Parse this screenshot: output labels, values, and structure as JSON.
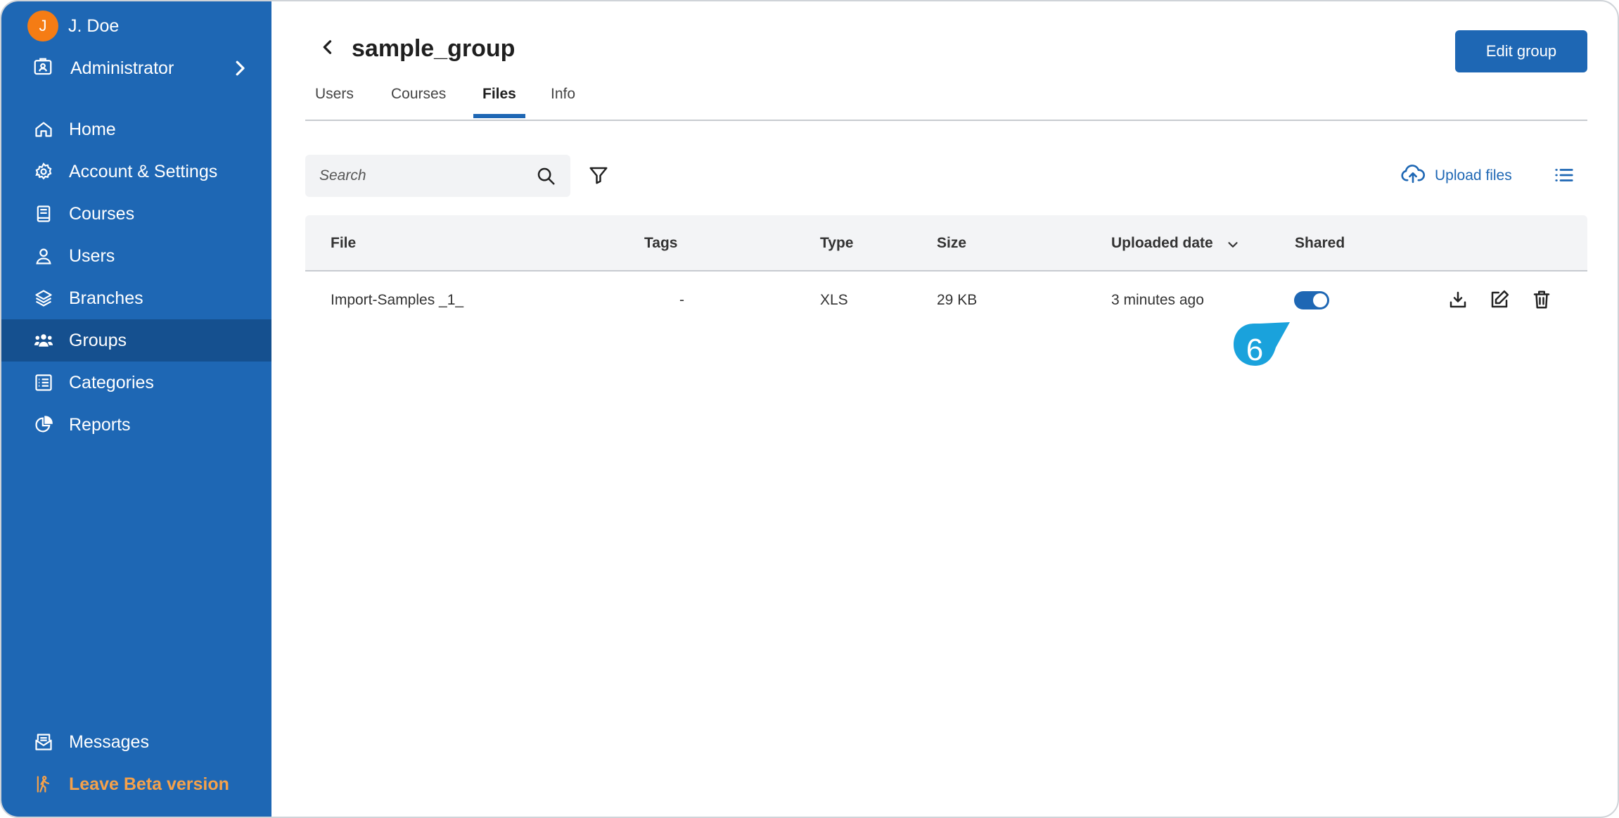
{
  "user": {
    "initial": "J",
    "name": "J. Doe"
  },
  "role": {
    "label": "Administrator"
  },
  "nav": {
    "items": [
      {
        "label": "Home",
        "icon": "home-icon"
      },
      {
        "label": "Account & Settings",
        "icon": "gear-icon"
      },
      {
        "label": "Courses",
        "icon": "book-icon"
      },
      {
        "label": "Users",
        "icon": "user-icon"
      },
      {
        "label": "Branches",
        "icon": "layers-icon"
      },
      {
        "label": "Groups",
        "icon": "group-icon",
        "active": true
      },
      {
        "label": "Categories",
        "icon": "list-box-icon"
      },
      {
        "label": "Reports",
        "icon": "pie-chart-icon"
      }
    ],
    "bottom": [
      {
        "label": "Messages",
        "icon": "envelope-icon"
      },
      {
        "label": "Leave Beta version",
        "icon": "exit-walk-icon"
      }
    ]
  },
  "page": {
    "title": "sample_group",
    "edit_label": "Edit group"
  },
  "tabs": [
    {
      "label": "Users"
    },
    {
      "label": "Courses"
    },
    {
      "label": "Files",
      "active": true
    },
    {
      "label": "Info"
    }
  ],
  "toolbar": {
    "search_placeholder": "Search",
    "upload_label": "Upload files"
  },
  "table": {
    "headers": {
      "file": "File",
      "tags": "Tags",
      "type": "Type",
      "size": "Size",
      "uploaded": "Uploaded date",
      "shared": "Shared"
    },
    "rows": [
      {
        "file": "Import-Samples _1_",
        "tags": "-",
        "type": "XLS",
        "size": "29 KB",
        "uploaded": "3 minutes ago",
        "shared": true
      }
    ]
  },
  "callout": {
    "number": "6"
  },
  "colors": {
    "sidebar": "#1e67b4",
    "sidebar_active": "#15508f",
    "accent": "#1e67b4",
    "avatar": "#f57c14",
    "beta": "#f5a14a",
    "callout": "#1aa2dc"
  }
}
